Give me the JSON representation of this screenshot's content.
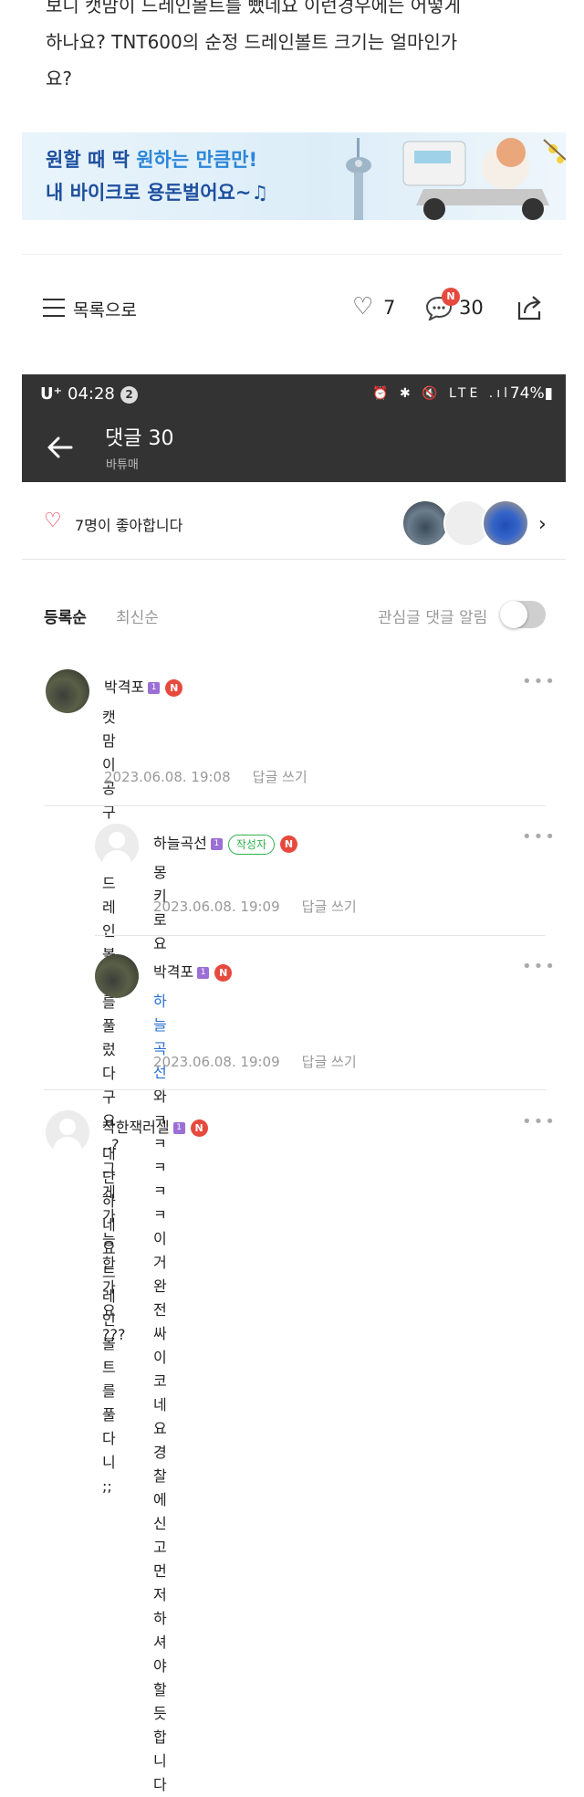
{
  "post": {
    "lines": [
      "보니 캣맘이 드레인볼트를 뺐네요 이런경우에는 어떻게",
      "하나요? TNT600의 순정 드레인볼트 크기는 얼마인가",
      "요?"
    ]
  },
  "banner": {
    "line1_a": "원할 때 딱 ",
    "line1_b": "원하는 만큼만!",
    "line2_a": "내 바이크로 ",
    "line2_b": "용돈벌어요~♫"
  },
  "list_bar": {
    "list_label": "목록으로",
    "like_count": "7",
    "comment_badge": "N",
    "comment_count": "30"
  },
  "status_bar": {
    "carrier": "U⁺",
    "time": "04:28",
    "notif_count": "2",
    "icons": "⏰ ✱ 🔇 LTE .ıl",
    "battery": "74%▮"
  },
  "app_bar": {
    "title": "댓글 30",
    "subtitle": "바튜매"
  },
  "likes": {
    "text": "7명이 좋아합니다"
  },
  "sort": {
    "by_registration": "등록순",
    "by_latest": "최신순",
    "alert_label": "관심글 댓글 알림",
    "alert_on": false
  },
  "comments": [
    {
      "author": "박격포",
      "level": "1",
      "badge": "N",
      "is_author": false,
      "author_tag": "",
      "mention": "",
      "lines": [
        "캣맘이 공구없이 드레인볼트를 풀렀다구요 ..? 그게 가능한",
        "가요 ???"
      ],
      "date": "2023.06.08. 19:08",
      "reply_label": "답글 쓰기"
    },
    {
      "author": "하늘곡선",
      "level": "1",
      "badge": "N",
      "is_author": true,
      "author_tag": "작성자",
      "mention": "",
      "lines": [
        "몽키로요"
      ],
      "date": "2023.06.08. 19:09",
      "reply_label": "답글 쓰기"
    },
    {
      "author": "박격포",
      "level": "1",
      "badge": "N",
      "is_author": false,
      "author_tag": "",
      "mention": "하늘곡선",
      "lines": [
        " 와 ㅋㅋㅋㅋㅋ 이거 완전 싸이코네요 경찰에",
        "신고먼저 하셔야할듯합니다"
      ],
      "date": "2023.06.08. 19:09",
      "reply_label": "답글 쓰기"
    },
    {
      "author": "착한잭러셀",
      "level": "1",
      "badge": "N",
      "is_author": false,
      "author_tag": "",
      "mention": "",
      "lines": [
        "대단하네요 드레인볼트를 풀다니 ;;"
      ],
      "date": "",
      "reply_label": ""
    }
  ],
  "more_glyph": "•••",
  "colors": {
    "app_bar_bg": "#333333",
    "accent_red": "#e64a3e",
    "author_green": "#2fb34c",
    "mention_blue": "#2b6fd1",
    "banner_text": "#1d4f9f"
  }
}
